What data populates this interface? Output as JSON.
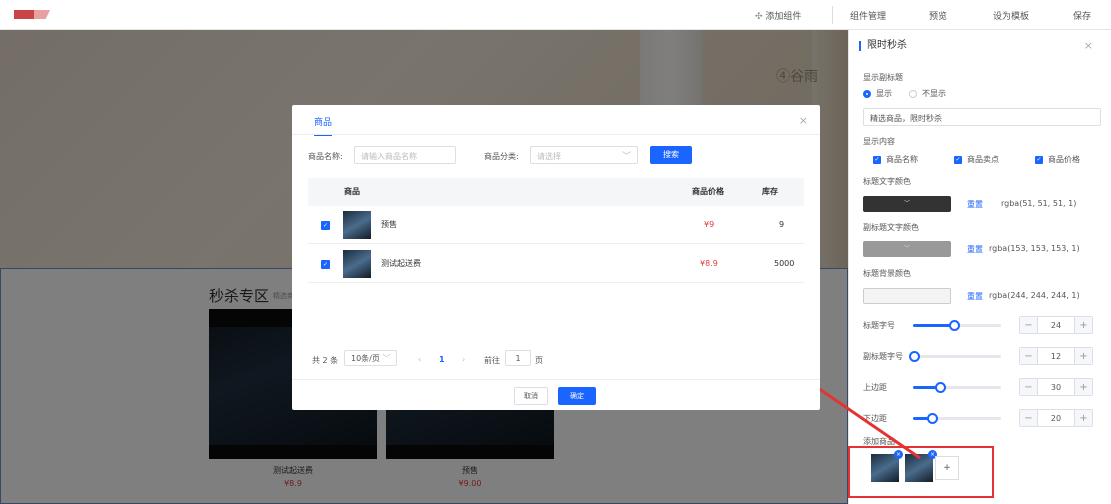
{
  "topbar": {
    "add_component": "添加组件",
    "component_manage": "组件管理",
    "preview": "预览",
    "set_template": "设为模板",
    "save": "保存"
  },
  "canvas": {
    "brand_mark": "④谷雨",
    "seckill_title": "秒杀专区",
    "seckill_subtitle": "精选商",
    "products": [
      {
        "name": "测试起送费",
        "price": "¥8.9"
      },
      {
        "name": "预售",
        "price": "¥9.00"
      }
    ]
  },
  "panel": {
    "title": "限时秒杀",
    "show_subtitle_label": "显示副标题",
    "show_option": "显示",
    "hide_option": "不显示",
    "subtitle_value": "精选商品，限时秒杀",
    "show_content_label": "显示内容",
    "content_options": [
      "商品名称",
      "商品卖点",
      "商品价格"
    ],
    "title_color_label": "标题文字颜色",
    "title_color_value": "rgba(51, 51, 51, 1)",
    "subtitle_color_label": "副标题文字颜色",
    "subtitle_color_value": "rgba(153, 153, 153, 1)",
    "title_bg_label": "标题背景颜色",
    "title_bg_value": "rgba(244, 244, 244, 1)",
    "reset": "重置",
    "swatch_arrow": "﹀",
    "sliders": [
      {
        "label": "标题字号",
        "value": "24",
        "level": 0.45
      },
      {
        "label": "副标题字号",
        "value": "12",
        "level": 0.0
      },
      {
        "label": "上边距",
        "value": "30",
        "level": 0.3
      },
      {
        "label": "下边距",
        "value": "20",
        "level": 0.2
      }
    ],
    "add_goods_label": "添加商品",
    "add_symbol": "+",
    "remove_symbol": "×",
    "colors": {
      "accent": "#1a64ff",
      "title_color": "#333333",
      "subtitle_color": "#999999",
      "title_bg": "#f4f4f4",
      "highlight": "#e53333"
    }
  },
  "dialog": {
    "tab": "商品",
    "name_label": "商品名称:",
    "name_placeholder": "请输入商品名称",
    "category_label": "商品分类:",
    "category_placeholder": "请选择",
    "search_button": "搜索",
    "columns": {
      "name": "商品",
      "price": "商品价格",
      "stock": "库存"
    },
    "rows": [
      {
        "name": "预售",
        "price": "¥9",
        "stock": "9"
      },
      {
        "name": "测试起送费",
        "price": "¥8.9",
        "stock": "5000"
      }
    ],
    "pager": {
      "total": "共 2 条",
      "page_size": "10条/页",
      "prev": "‹",
      "current": "1",
      "next": "›",
      "goto": "前往",
      "goto_value": "1",
      "page_unit": "页"
    },
    "cancel": "取消",
    "confirm": "确定",
    "close": "×"
  }
}
